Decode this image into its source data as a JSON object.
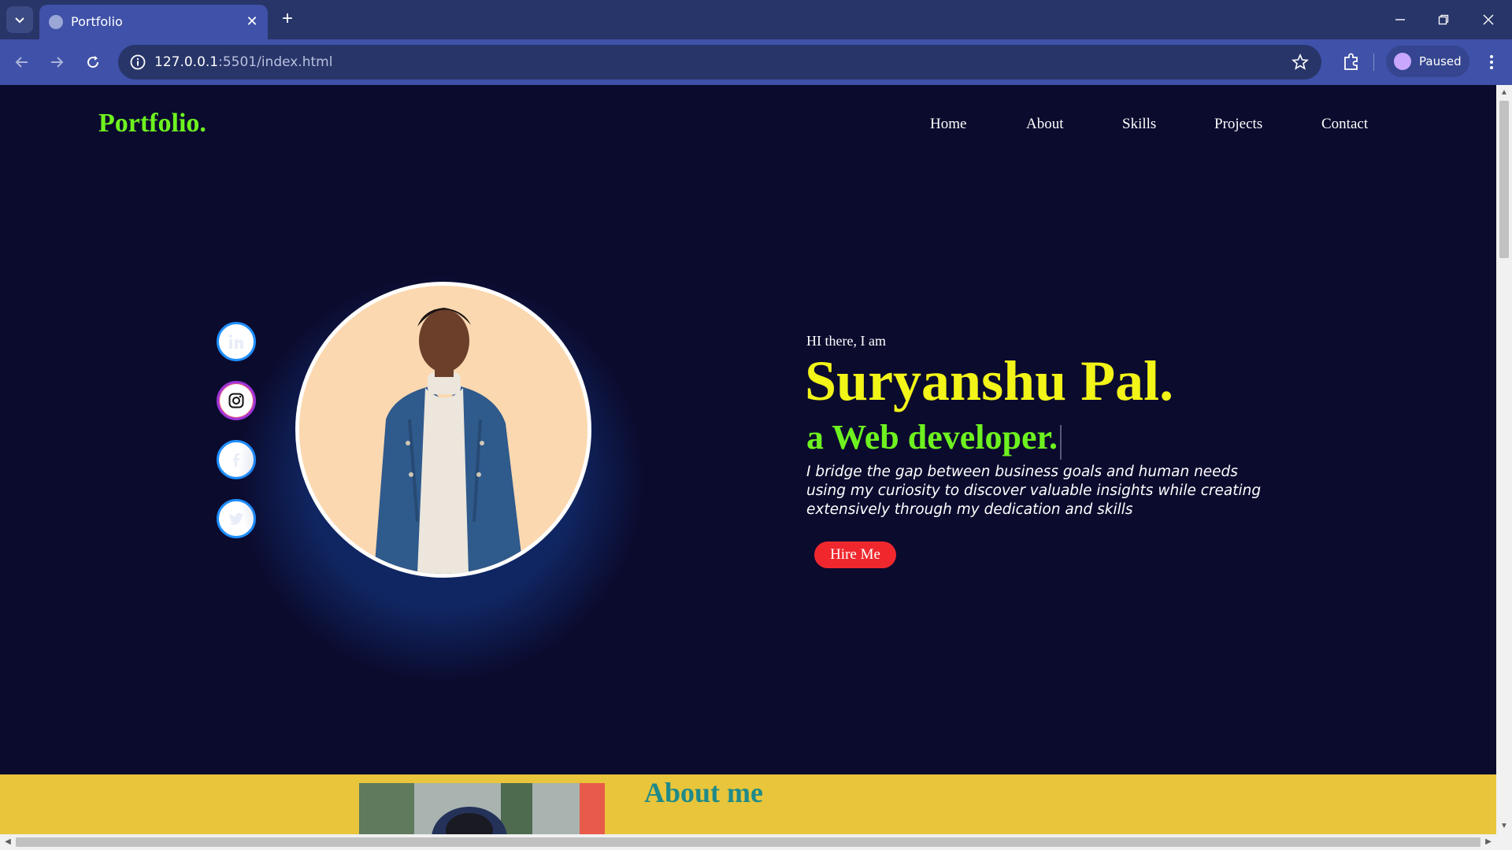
{
  "browser": {
    "tab": {
      "title": "Portfolio"
    },
    "address": {
      "host": "127.0.0.1",
      "port_path": ":5501/index.html"
    },
    "profile": {
      "label": "Paused"
    }
  },
  "site": {
    "logo": "Portfolio.",
    "nav": [
      "Home",
      "About",
      "Skills",
      "Projects",
      "Contact"
    ],
    "socials": [
      "linkedin-icon",
      "instagram-icon",
      "facebook-icon",
      "twitter-icon"
    ],
    "hero": {
      "greeting": "HI there, I am",
      "name": "Suryanshu Pal.",
      "role": "a Web developer.",
      "bio": "I bridge the gap between business goals and human needs using my curiosity to discover valuable insights while creating extensively through my dedication and skills",
      "cta": "Hire Me"
    },
    "about": {
      "title": "About me"
    }
  },
  "colors": {
    "page_bg": "#0b0b2e",
    "logo": "#6ef21f",
    "name": "#f2f517",
    "role": "#6ef21f",
    "cta": "#f0282e",
    "about_bg": "#e8c53a",
    "about_title": "#1f8a8a",
    "chrome": "#3f51a8"
  }
}
